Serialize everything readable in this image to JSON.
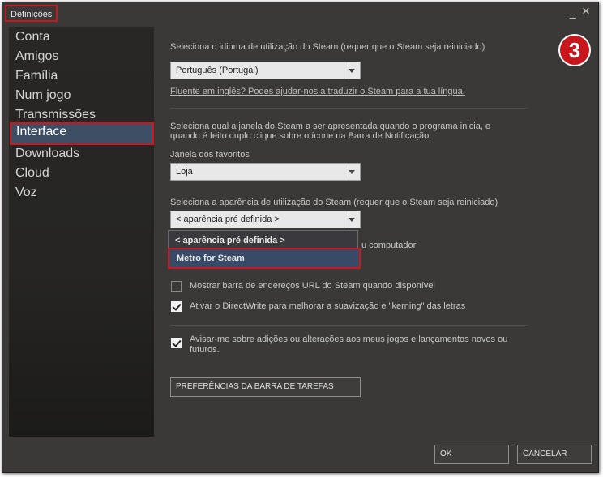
{
  "window": {
    "title": "Definições",
    "minimize_glyph": "_",
    "close_glyph": "×"
  },
  "sidebar": {
    "items": [
      {
        "label": "Conta"
      },
      {
        "label": "Amigos"
      },
      {
        "label": "Família"
      },
      {
        "label": "Num jogo"
      },
      {
        "label": "Transmissões"
      },
      {
        "label": "Interface",
        "active": true
      },
      {
        "label": "Downloads"
      },
      {
        "label": "Cloud"
      },
      {
        "label": "Voz"
      }
    ]
  },
  "language": {
    "description": "Seleciona o idioma de utilização do Steam (requer que o Steam seja reiniciado)",
    "value": "Português (Portugal)",
    "help_link": "Fluente em inglês? Podes ajudar-nos a traduzir o Steam para a tua língua."
  },
  "startup": {
    "description_line1": "Seleciona qual a janela do Steam a ser apresentada quando o programa inicia, e",
    "description_line2": "quando é feito duplo clique sobre o ícone na Barra de Notificação.",
    "label": "Janela dos favoritos",
    "value": "Loja"
  },
  "skin": {
    "description": "Seleciona a aparência de utilização do Steam (requer que o Steam seja reiniciado)",
    "value": "< aparência pré definida >",
    "options": [
      "< aparência pré definida >",
      "Metro for Steam"
    ],
    "selected_option": "Metro for Steam",
    "obscured_text_fragment": "u computador"
  },
  "checkboxes": [
    {
      "label": "Mostrar barra de endereços URL do Steam quando disponível",
      "checked": false
    },
    {
      "label": "Ativar o DirectWrite para melhorar a suavização e \"kerning\" das letras",
      "checked": true
    },
    {
      "label_line1": "Avisar-me sobre adições ou alterações aos meus jogos e lançamentos novos ou",
      "label_line2": "futuros.",
      "checked": true
    }
  ],
  "taskbar_button": "PREFERÊNCIAS DA BARRA DE TAREFAS",
  "footer": {
    "ok": "OK",
    "cancel": "CANCELAR"
  },
  "step_badge": "3",
  "colors": {
    "highlight": "#d0161c",
    "selection": "#3e4e64",
    "background": "#3a3937"
  }
}
